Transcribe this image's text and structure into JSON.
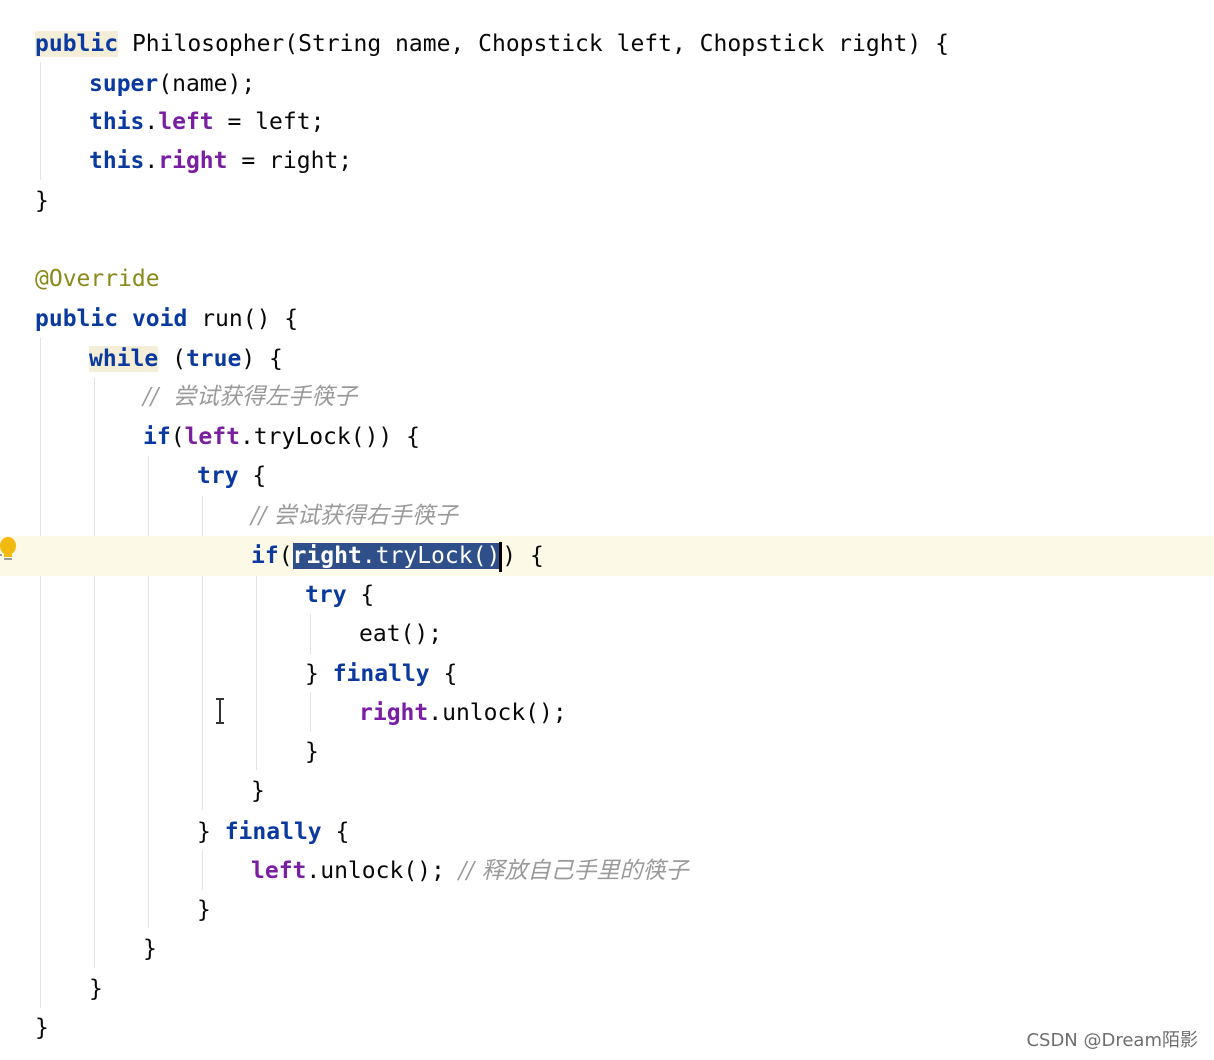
{
  "code": {
    "l1": {
      "kw": "public",
      "text": " Philosopher(String name, Chopstick left, Chopstick right) {"
    },
    "l2": {
      "kw": "super",
      "text": "(name);"
    },
    "l3": {
      "kw": "this",
      "dot": ".",
      "field": "left",
      "text": " = left;"
    },
    "l4": {
      "kw": "this",
      "dot": ".",
      "field": "right",
      "text": " = right;"
    },
    "l5": {
      "text": "}"
    },
    "l6": {
      "ann": "@Override"
    },
    "l7": {
      "kw1": "public",
      "sp1": " ",
      "kw2": "void",
      "text": " run() {"
    },
    "l8": {
      "kw": "while",
      "sp": " (",
      "kw2": "true",
      "text": ") {"
    },
    "l9": {
      "comment": "//  尝试获得左手筷子"
    },
    "l10": {
      "kw": "if",
      "open": "(",
      "field": "left",
      "text": ".tryLock()) {"
    },
    "l11": {
      "kw": "try",
      "text": " {"
    },
    "l12": {
      "comment": "// 尝试获得右手筷子"
    },
    "l13": {
      "kw": "if",
      "open": "(",
      "sel_field": "right",
      "sel_text": ".tryLock(",
      "sel_close": ")",
      "text": ") {"
    },
    "l14": {
      "kw": "try",
      "text": " {"
    },
    "l15": {
      "text": "eat();"
    },
    "l16": {
      "pre": "} ",
      "kw": "finally",
      "text": " {"
    },
    "l17": {
      "field": "right",
      "text": ".unlock();"
    },
    "l18": {
      "text": "}"
    },
    "l19": {
      "text": "}"
    },
    "l20": {
      "pre": "} ",
      "kw": "finally",
      "text": " {"
    },
    "l21": {
      "field": "left",
      "text": ".unlock(); ",
      "comment": "// 释放自己手里的筷子"
    },
    "l22": {
      "text": "}"
    },
    "l23": {
      "text": "}"
    },
    "l24": {
      "text": "}"
    },
    "l25": {
      "text": "}"
    }
  },
  "gutter": {
    "bulb_icon": "lightbulb-icon"
  },
  "cursor": {
    "icon": "text-cursor-icon"
  },
  "watermark": "CSDN @Dream陌影",
  "colors": {
    "keyword": "#0b3a9e",
    "field": "#7a1fa2",
    "annotation": "#8a8a1a",
    "comment": "#9a9a9a",
    "selection": "#2f4f8a",
    "current_line": "#fcfae6"
  }
}
